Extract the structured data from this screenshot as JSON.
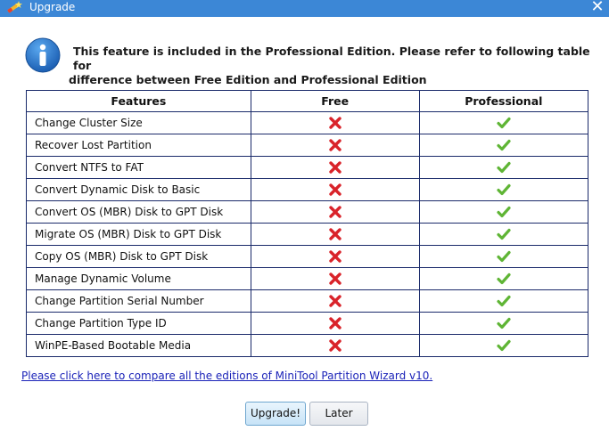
{
  "window": {
    "title": "Upgrade",
    "close_label": "✕"
  },
  "intro": {
    "line1": "This feature is included in the Professional Edition. Please refer to following table for",
    "line2": "difference between Free Edition and Professional Edition"
  },
  "table": {
    "headers": [
      "Features",
      "Free",
      "Professional"
    ],
    "rows": [
      {
        "feature": "Change Cluster Size",
        "free": false,
        "professional": true
      },
      {
        "feature": "Recover Lost Partition",
        "free": false,
        "professional": true
      },
      {
        "feature": "Convert NTFS to FAT",
        "free": false,
        "professional": true
      },
      {
        "feature": "Convert Dynamic Disk to Basic",
        "free": false,
        "professional": true
      },
      {
        "feature": "Convert OS (MBR) Disk to GPT Disk",
        "free": false,
        "professional": true
      },
      {
        "feature": "Migrate OS (MBR) Disk to GPT Disk",
        "free": false,
        "professional": true
      },
      {
        "feature": "Copy OS (MBR) Disk to GPT Disk",
        "free": false,
        "professional": true
      },
      {
        "feature": "Manage Dynamic Volume",
        "free": false,
        "professional": true
      },
      {
        "feature": "Change Partition Serial Number",
        "free": false,
        "professional": true
      },
      {
        "feature": "Change Partition Type ID",
        "free": false,
        "professional": true
      },
      {
        "feature": "WinPE-Based Bootable Media",
        "free": false,
        "professional": true
      }
    ]
  },
  "compare_link": "Please click here to compare all the editions of MiniTool Partition Wizard v10.",
  "buttons": {
    "upgrade": "Upgrade!",
    "later": "Later"
  },
  "icons": {
    "title": "wand-icon",
    "info": "info-icon",
    "not_included": "red-cross-icon",
    "included": "green-check-icon"
  },
  "colors": {
    "titlebar": "#3c87d6",
    "table_border": "#1a2a6a",
    "link": "#1a22b8",
    "cross": "#d9232a",
    "check": "#5fb535"
  }
}
